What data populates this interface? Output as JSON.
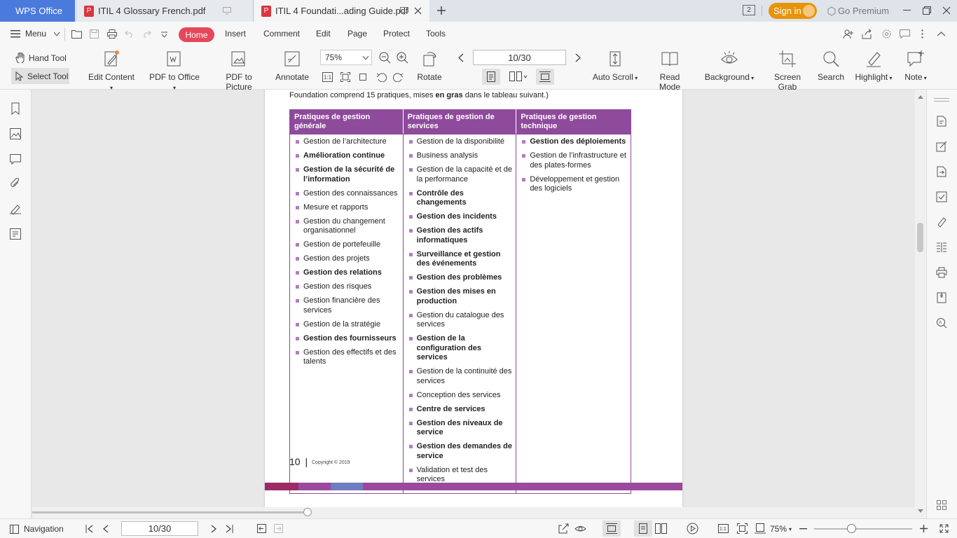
{
  "tabs": {
    "app": "WPS Office",
    "doc1": "ITIL 4 Glossary French.pdf",
    "doc2": "ITIL 4 Foundati...ading Guide.pdf",
    "badge": "2",
    "signin": "Sign in",
    "premium": "Go Premium"
  },
  "menubar": {
    "menu": "Menu",
    "items": [
      "Home",
      "Insert",
      "Comment",
      "Edit",
      "Page",
      "Protect",
      "Tools"
    ]
  },
  "toolbar": {
    "hand_tool": "Hand Tool",
    "select_tool": "Select Tool",
    "edit_content": "Edit Content",
    "pdf_to_office": "PDF to Office",
    "pdf_to_picture": "PDF to Picture",
    "annotate": "Annotate",
    "zoom": "75%",
    "page": "10/30",
    "rotate": "Rotate",
    "auto_scroll": "Auto Scroll",
    "read_mode": "Read Mode",
    "background": "Background",
    "screen_grab": "Screen Grab",
    "search": "Search",
    "highlight": "Highlight",
    "note": "Note"
  },
  "document": {
    "intro_pre": "Foundation comprend 15 pratiques, mises ",
    "intro_bold": "en gras",
    "intro_post": " dans le tableau suivant.)",
    "headers": [
      "Pratiques de gestion générale",
      "Pratiques de gestion de services",
      "Pratiques de gestion technique"
    ],
    "col1": [
      {
        "t": "Gestion de l’architecture",
        "b": false
      },
      {
        "t": "Amélioration continue",
        "b": true
      },
      {
        "t": "Gestion de la sécurité de l’information",
        "b": true
      },
      {
        "t": "Gestion des connaissances",
        "b": false
      },
      {
        "t": "Mesure et rapports",
        "b": false
      },
      {
        "t": "Gestion du changement organisationnel",
        "b": false
      },
      {
        "t": "Gestion de portefeuille",
        "b": false
      },
      {
        "t": "Gestion des projets",
        "b": false
      },
      {
        "t": "Gestion des relations",
        "b": true
      },
      {
        "t": "Gestion des risques",
        "b": false
      },
      {
        "t": "Gestion financière des services",
        "b": false
      },
      {
        "t": "Gestion de la stratégie",
        "b": false
      },
      {
        "t": "Gestion des fournisseurs",
        "b": true
      },
      {
        "t": "Gestion des effectifs et des talents",
        "b": false
      }
    ],
    "col2": [
      {
        "t": "Gestion de la disponibilité",
        "b": false
      },
      {
        "t": "Business analysis",
        "b": false
      },
      {
        "t": "Gestion de la capacité et de la performance",
        "b": false
      },
      {
        "t": "Contrôle des changements",
        "b": true
      },
      {
        "t": "Gestion des incidents",
        "b": true
      },
      {
        "t": "Gestion des actifs informatiques",
        "b": true
      },
      {
        "t": "Surveillance et gestion des événements",
        "b": true
      },
      {
        "t": "Gestion des problèmes",
        "b": true
      },
      {
        "t": "Gestion des mises en production",
        "b": true
      },
      {
        "t": "Gestion du catalogue des services",
        "b": false
      },
      {
        "t": "Gestion de la configuration des services",
        "b": true
      },
      {
        "t": "Gestion de la continuité des services",
        "b": false
      },
      {
        "t": "Conception des services",
        "b": false
      },
      {
        "t": "Centre de services",
        "b": true
      },
      {
        "t": "Gestion des niveaux de service",
        "b": true
      },
      {
        "t": "Gestion des demandes de service",
        "b": true
      },
      {
        "t": "Validation et test des services",
        "b": false
      }
    ],
    "col3": [
      {
        "t": "Gestion des déploiements",
        "b": true
      },
      {
        "t": "Gestion de l’infrastructure et des plates-formes",
        "b": false
      },
      {
        "t": "Développement et gestion des logiciels",
        "b": false
      }
    ],
    "page_number": "10",
    "copyright": "Copyright © 2019"
  },
  "status": {
    "navigation": "Navigation",
    "page": "10/30",
    "zoom": "75%"
  },
  "colors": {
    "accent": "#8e4a9b",
    "wps_blue": "#4a7bdc",
    "home_red": "#e5485a",
    "signin_orange": "#e8940a"
  }
}
